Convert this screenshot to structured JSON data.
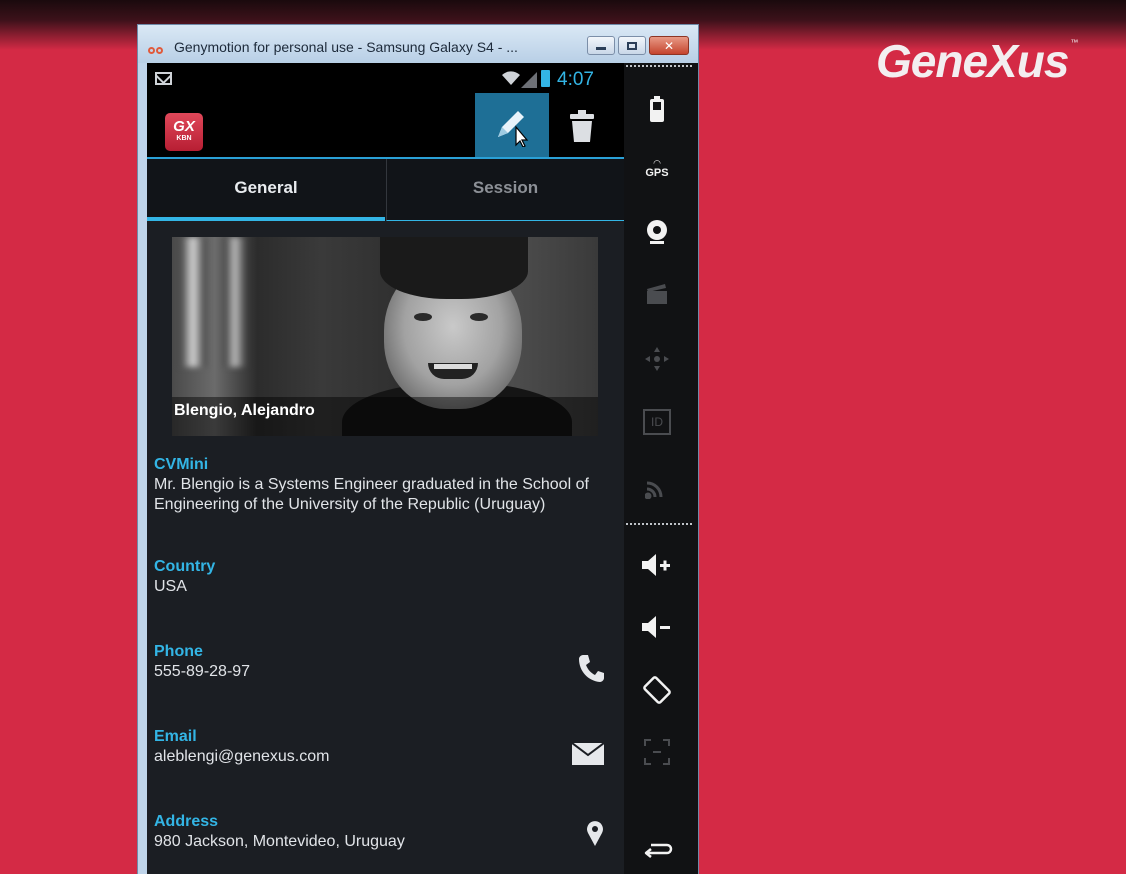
{
  "brand": {
    "name": "GeneXus",
    "tm": "™"
  },
  "window": {
    "title": "Genymotion for personal use - Samsung Galaxy S4 - ...",
    "buttons": {
      "minimize": "minimize",
      "maximize": "maximize",
      "close": "close"
    }
  },
  "statusbar": {
    "time": "4:07",
    "icons": [
      "gmail-icon",
      "wifi-icon",
      "signal-icon",
      "battery-icon"
    ]
  },
  "appbar": {
    "logo_line1": "GX",
    "logo_line2": "KBN",
    "actions": [
      "edit-icon",
      "trash-icon"
    ]
  },
  "tabs": [
    {
      "label": "General",
      "selected": true
    },
    {
      "label": "Session",
      "selected": false
    }
  ],
  "profile": {
    "name": "Blengio, Alejandro"
  },
  "fields": {
    "cvmini": {
      "label": "CVMini",
      "value": "Mr. Blengio is a Systems Engineer graduated in the School of Engineering of the University of the Republic (Uruguay)"
    },
    "country": {
      "label": "Country",
      "value": "USA"
    },
    "phone": {
      "label": "Phone",
      "value": "555-89-28-97",
      "icon": "phone-icon"
    },
    "email": {
      "label": "Email",
      "value": "aleblengi@genexus.com",
      "icon": "envelope-icon"
    },
    "address": {
      "label": "Address",
      "value": "980 Jackson, Montevideo, Uruguay",
      "icon": "map-pin-icon"
    }
  },
  "sidebar": {
    "gps_label": "GPS",
    "id_label": "ID",
    "items": [
      "battery-icon",
      "gps-icon",
      "camera-icon",
      "media-icon",
      "dpad-icon",
      "id-icon",
      "cast-icon",
      "volume-up-icon",
      "volume-down-icon",
      "rotate-icon",
      "pixel-perfect-icon",
      "back-icon"
    ]
  },
  "colors": {
    "background": "#d42a45",
    "accent": "#33b5e5",
    "screen": "#1b1e23"
  }
}
